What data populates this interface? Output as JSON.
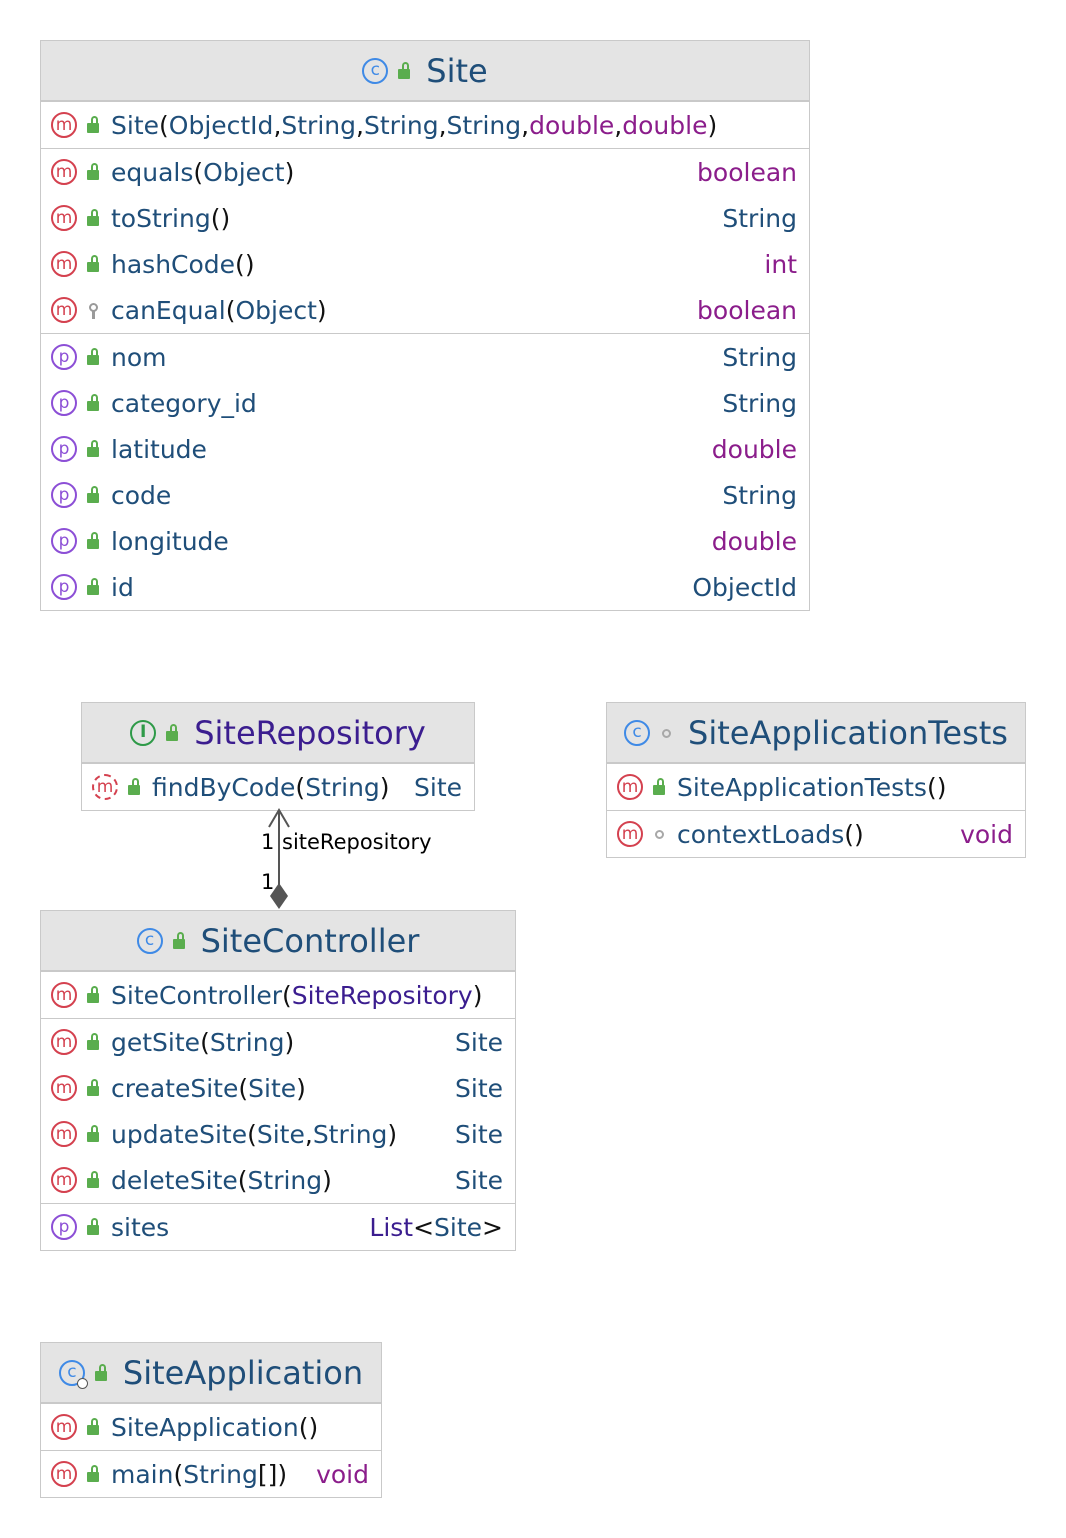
{
  "site": {
    "name": "Site",
    "constructor": {
      "name": "Site",
      "open": "(",
      "params": [
        "ObjectId",
        ", ",
        "String",
        ", ",
        "String",
        ", ",
        "String",
        ", ",
        "double",
        ", ",
        "double"
      ],
      "close": ")"
    },
    "methods": [
      {
        "name": "equals",
        "open": "(",
        "param": "Object",
        "close": ")",
        "ret": "boolean"
      },
      {
        "name": "toString",
        "open": "(",
        "param": "",
        "close": ")",
        "ret": "String"
      },
      {
        "name": "hashCode",
        "open": "(",
        "param": "",
        "close": ")",
        "ret": "int"
      },
      {
        "name": "canEqual",
        "open": "(",
        "param": "Object",
        "close": ")",
        "ret": "boolean"
      }
    ],
    "properties": [
      {
        "name": "nom",
        "type": "String"
      },
      {
        "name": "category_id",
        "type": "String"
      },
      {
        "name": "latitude",
        "type": "double"
      },
      {
        "name": "code",
        "type": "String"
      },
      {
        "name": "longitude",
        "type": "double"
      },
      {
        "name": "id",
        "type": "ObjectId"
      }
    ]
  },
  "repository": {
    "name": "SiteRepository",
    "methods": [
      {
        "name": "findByCode",
        "open": "(",
        "param": "String",
        "close": ")",
        "ret": "Site"
      }
    ]
  },
  "tests": {
    "name": "SiteApplicationTests",
    "constructor": {
      "name": "SiteApplicationTests",
      "paren": "()"
    },
    "methods": [
      {
        "name": "contextLoads",
        "paren": "()",
        "ret": "void"
      }
    ]
  },
  "controller": {
    "name": "SiteController",
    "constructor": {
      "name": "SiteController",
      "open": "(",
      "param": "SiteRepository",
      "close": ")"
    },
    "methods": [
      {
        "name": "getSite",
        "open": "(",
        "p1": "String",
        "sep": "",
        "p2": "",
        "close": ")",
        "ret": "Site"
      },
      {
        "name": "createSite",
        "open": "(",
        "p1": "Site",
        "sep": "",
        "p2": "",
        "close": ")",
        "ret": "Site"
      },
      {
        "name": "updateSite",
        "open": "(",
        "p1": "Site",
        "sep": ", ",
        "p2": "String",
        "close": ")",
        "ret": "Site"
      },
      {
        "name": "deleteSite",
        "open": "(",
        "p1": "String",
        "sep": "",
        "p2": "",
        "close": ")",
        "ret": "Site"
      }
    ],
    "properties": [
      {
        "name": "sites",
        "type1": "List",
        "lt": "<",
        "type2": "Site",
        "gt": ">"
      }
    ]
  },
  "application": {
    "name": "SiteApplication",
    "constructor": {
      "name": "SiteApplication",
      "paren": "()"
    },
    "methods": [
      {
        "name": "main",
        "open": "(",
        "param": "String",
        "arr": "[]",
        "close": ")",
        "ret": "void"
      }
    ]
  },
  "edge": {
    "label": "siteRepository",
    "mult_source": "1",
    "mult_target": "1"
  },
  "icons": {
    "class": "class-icon",
    "interface": "interface-icon",
    "method": "method-icon",
    "abstract_method": "abstract-method-icon",
    "property": "property-icon",
    "public": "public-lock-icon",
    "protected": "protected-key-icon",
    "package_private": "package-private-icon"
  },
  "colors": {
    "header_bg": "#e4e4e4",
    "border": "#c9c9c9",
    "identifier": "#1f4e79",
    "keyword": "#8b1d8b",
    "interface_name": "#3b1d8f",
    "method_icon": "#d4414f",
    "property_icon": "#8c4fd6",
    "class_icon": "#3f8ae6",
    "interface_icon": "#2e9a48",
    "public_icon": "#5aad4e"
  }
}
